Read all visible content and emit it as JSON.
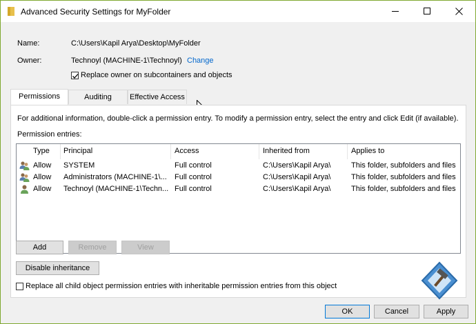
{
  "window": {
    "title": "Advanced Security Settings for MyFolder"
  },
  "info": {
    "name_label": "Name:",
    "name_value": "C:\\Users\\Kapil Arya\\Desktop\\MyFolder",
    "owner_label": "Owner:",
    "owner_value": "Technoyl (MACHINE-1\\Technoyl)",
    "change_link": "Change",
    "replace_owner_label": "Replace owner on subcontainers and objects",
    "replace_owner_checked": true
  },
  "tabs": [
    {
      "label": "Permissions",
      "active": true
    },
    {
      "label": "Auditing",
      "active": false
    },
    {
      "label": "Effective Access",
      "active": false
    }
  ],
  "permissions": {
    "info_text": "For additional information, double-click a permission entry. To modify a permission entry, select the entry and click Edit (if available).",
    "entries_label": "Permission entries:",
    "columns": [
      "Type",
      "Principal",
      "Access",
      "Inherited from",
      "Applies to"
    ],
    "rows": [
      {
        "icon": "user-group-icon",
        "type": "Allow",
        "principal": "SYSTEM",
        "access": "Full control",
        "inherited": "C:\\Users\\Kapil Arya\\",
        "applies": "This folder, subfolders and files"
      },
      {
        "icon": "user-group-icon",
        "type": "Allow",
        "principal": "Administrators (MACHINE-1\\...",
        "access": "Full control",
        "inherited": "C:\\Users\\Kapil Arya\\",
        "applies": "This folder, subfolders and files"
      },
      {
        "icon": "user-icon",
        "type": "Allow",
        "principal": "Technoyl (MACHINE-1\\Techn...",
        "access": "Full control",
        "inherited": "C:\\Users\\Kapil Arya\\",
        "applies": "This folder, subfolders and files"
      }
    ],
    "add_label": "Add",
    "remove_label": "Remove",
    "view_label": "View",
    "disable_inheritance_label": "Disable inheritance",
    "replace_child_label": "Replace all child object permission entries with inheritable permission entries from this object",
    "replace_child_checked": false
  },
  "footer": {
    "ok_label": "OK",
    "cancel_label": "Cancel",
    "apply_label": "Apply"
  },
  "colors": {
    "accent": "#0078d7",
    "link": "#0066cc",
    "window_border": "#7fa82f"
  }
}
